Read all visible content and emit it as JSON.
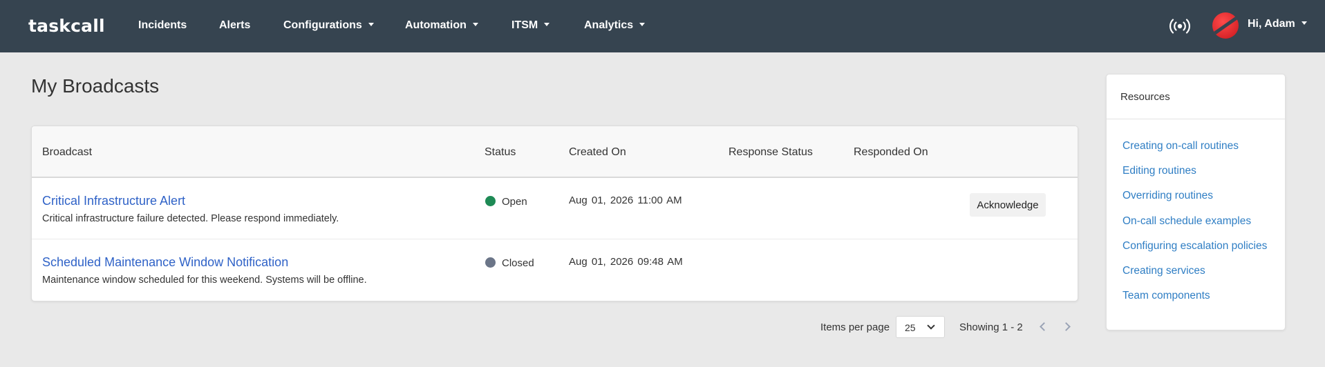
{
  "app": {
    "logo": "taskcall",
    "nav": [
      {
        "label": "Incidents",
        "dropdown": false
      },
      {
        "label": "Alerts",
        "dropdown": false
      },
      {
        "label": "Configurations",
        "dropdown": true
      },
      {
        "label": "Automation",
        "dropdown": true
      },
      {
        "label": "ITSM",
        "dropdown": true
      },
      {
        "label": "Analytics",
        "dropdown": true
      }
    ],
    "greeting": "Hi, Adam",
    "colors": {
      "navbar": "#364450",
      "link": "#2f62c7",
      "open": "#1e8a55",
      "closed": "#6b7588"
    }
  },
  "page": {
    "title": "My Broadcasts"
  },
  "table": {
    "headers": [
      "Broadcast",
      "Status",
      "Created On",
      "Response Status",
      "Responded On"
    ],
    "rows": [
      {
        "title": "Critical Infrastructure Alert",
        "description": "Critical infrastructure failure detected. Please respond immediately.",
        "status": "Open",
        "status_color": "#1e8a55",
        "created_on": "Aug 01, 2026  11:00 AM",
        "action": "Acknowledge"
      },
      {
        "title": "Scheduled Maintenance Window Notification",
        "description": "Maintenance window scheduled for this weekend. Systems will be offline.",
        "status": "Closed",
        "status_color": "#6b7588",
        "created_on": "Aug 01, 2026  09:48 AM"
      }
    ]
  },
  "pagination": {
    "items_per_page_label": "Items per page",
    "items_per_page": "25",
    "showing": "Showing 1 - 2"
  },
  "resources": {
    "title": "Resources",
    "links": [
      "Creating on-call routines",
      "Editing routines",
      "Overriding routines",
      "On-call schedule examples",
      "Configuring escalation policies",
      "Creating services",
      "Team components"
    ]
  }
}
